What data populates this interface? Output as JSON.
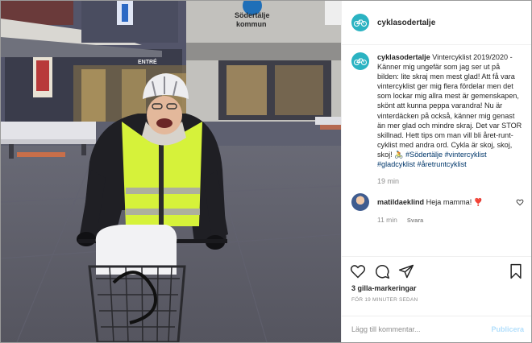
{
  "post": {
    "username": "cyklasodertalje",
    "caption_user": "cyklasodertalje",
    "caption_text": "Vintercyklist 2019/2020 - Känner mig ungefär som jag ser ut på bilden: lite skraj men mest glad! Att få vara vintercyklist ger mig flera fördelar men det som lockar mig allra mest är gemenskapen, skönt att kunna peppa varandra! Nu är vinterdäcken på också, känner mig genast än mer glad och mindre skraj. Det var STOR skillnad. Hett tips om man vill bli året-runt-cyklist med andra ord. Cykla är skoj, skoj, skoj! 🚴",
    "hashtags": "#Södertälje #vintercyklist #gladcyklist #åretruntcyklist",
    "caption_time": "19 min"
  },
  "comment": {
    "user": "matildaeklind",
    "text": "Heja mamma! ❣️",
    "time": "11 min",
    "reply": "Svara"
  },
  "actions": {
    "likes": "3 gilla-markeringar",
    "posted": "FÖR 19 MINUTER SEDAN"
  },
  "add_comment": {
    "placeholder": "Lägg till kommentar...",
    "post_button": "Publicera"
  },
  "photo": {
    "sign_text_1": "Södertälje",
    "sign_text_2": "kommun",
    "entrance_text": "ENTRÉ"
  },
  "colors": {
    "brand_teal": "#2bb3c2",
    "hashtag_blue": "#00376b",
    "publish_disabled": "#b2dffc",
    "vest_yellow": "#d6f23a"
  }
}
